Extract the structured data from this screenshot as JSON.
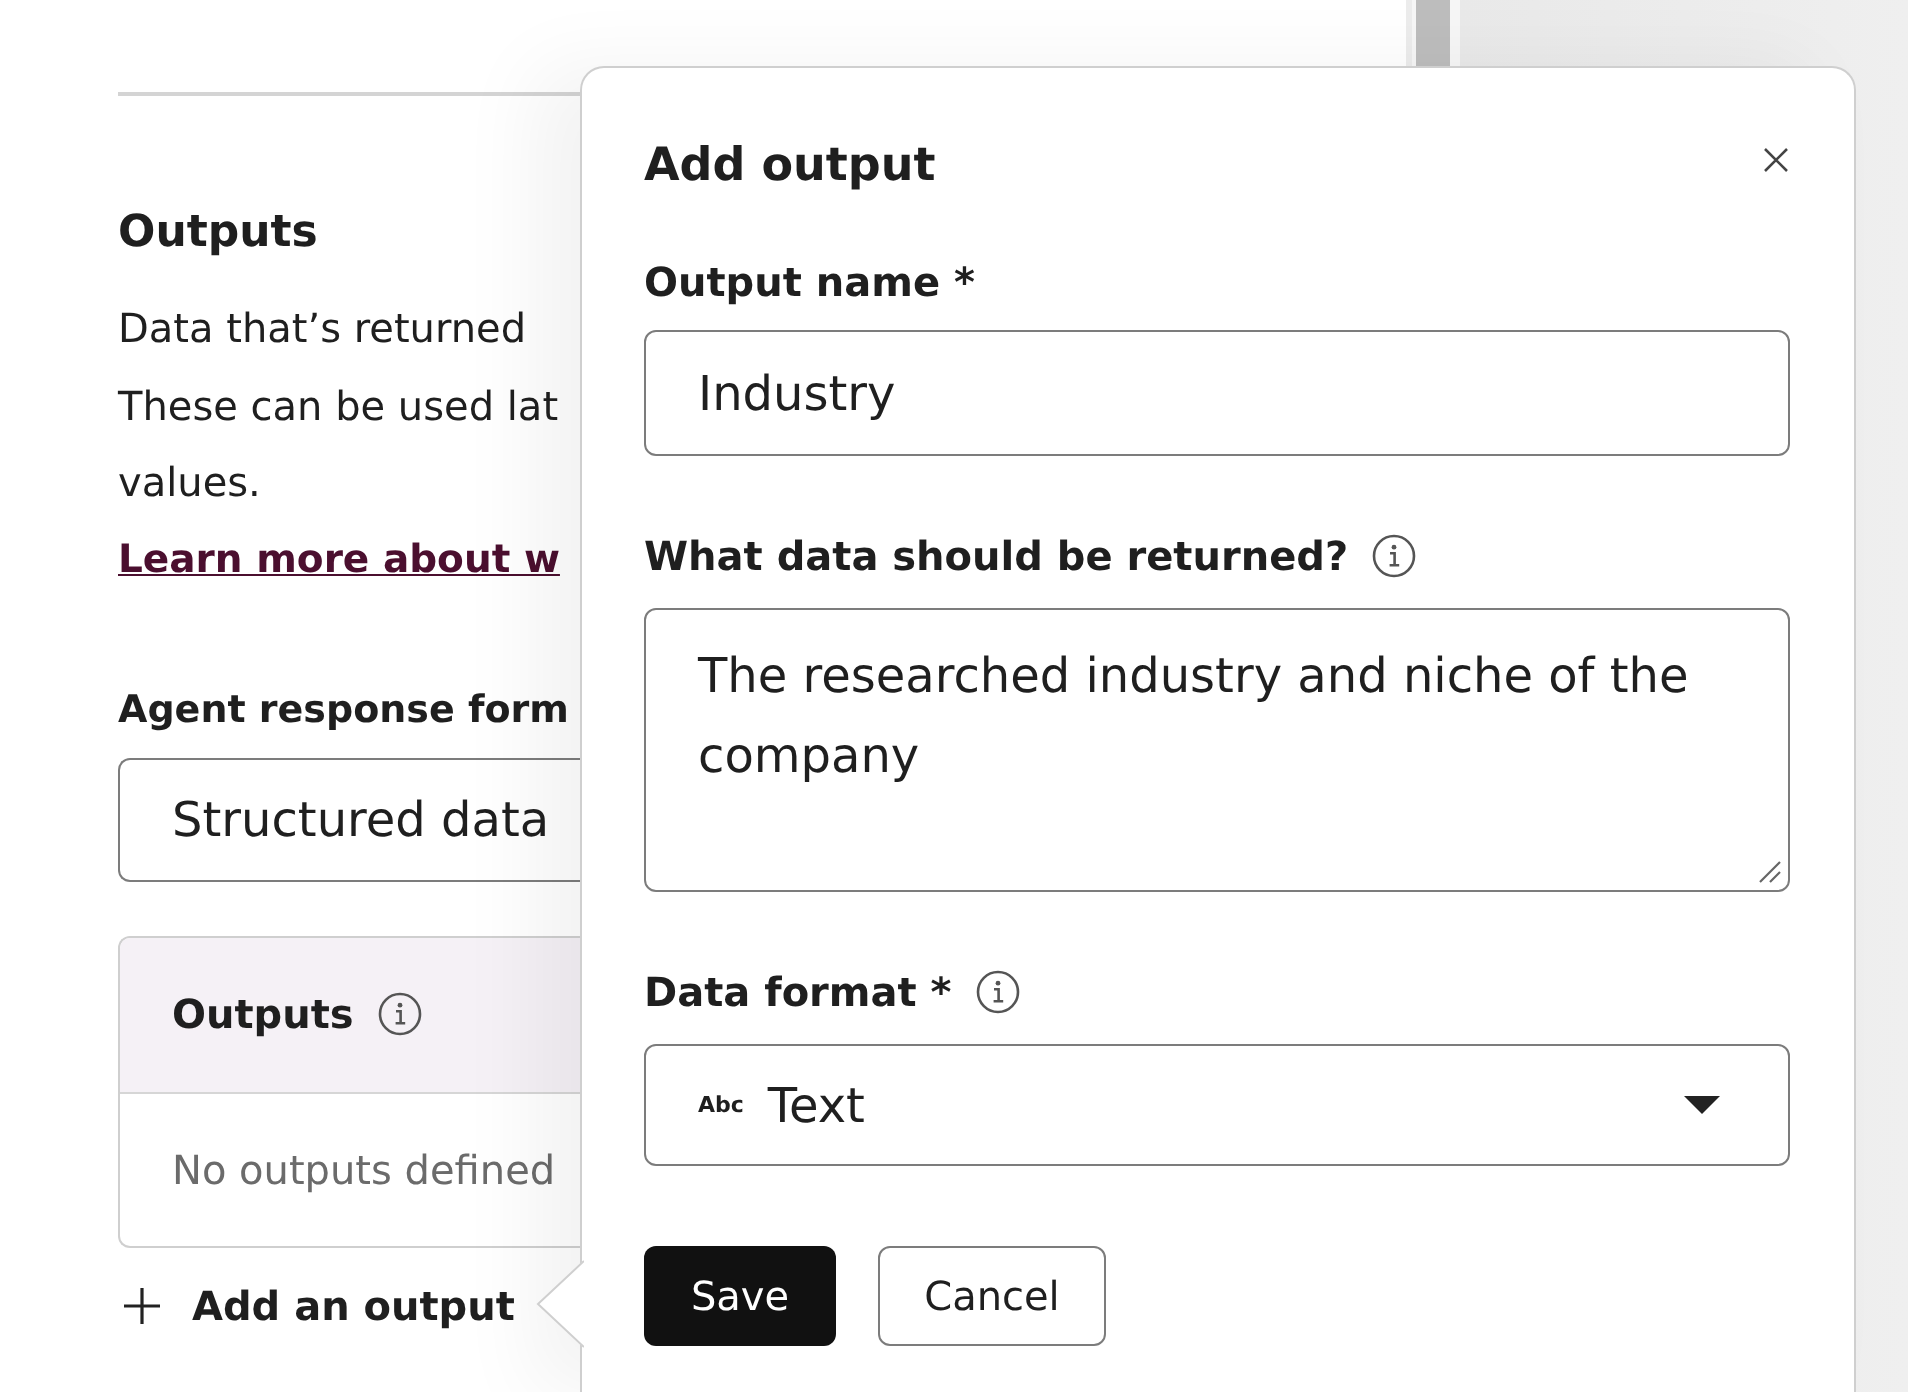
{
  "left_panel": {
    "section_title": "Outputs",
    "description_lines": [
      "Data that’s returned",
      "These can be used lat",
      "values."
    ],
    "link": "Learn more about w",
    "response_format": {
      "label": "Agent response form",
      "value": "Structured data"
    },
    "outputs_card": {
      "title": "Outputs",
      "info": true,
      "empty_text": "No outputs defined"
    },
    "add_button": "Add an output"
  },
  "popover": {
    "title": "Add output",
    "fields": [
      {
        "kind": "input",
        "label": "Output name *",
        "info": false,
        "value": "Industry"
      },
      {
        "kind": "textarea",
        "label": "What data should be returned?",
        "info": true,
        "value": "The researched industry and niche of the company"
      },
      {
        "kind": "select",
        "label": "Data format *",
        "info": true,
        "icon_text": "Abc",
        "value": "Text"
      }
    ],
    "buttons": [
      {
        "kind": "primary",
        "label": "Save"
      },
      {
        "kind": "secondary",
        "label": "Cancel"
      }
    ]
  }
}
